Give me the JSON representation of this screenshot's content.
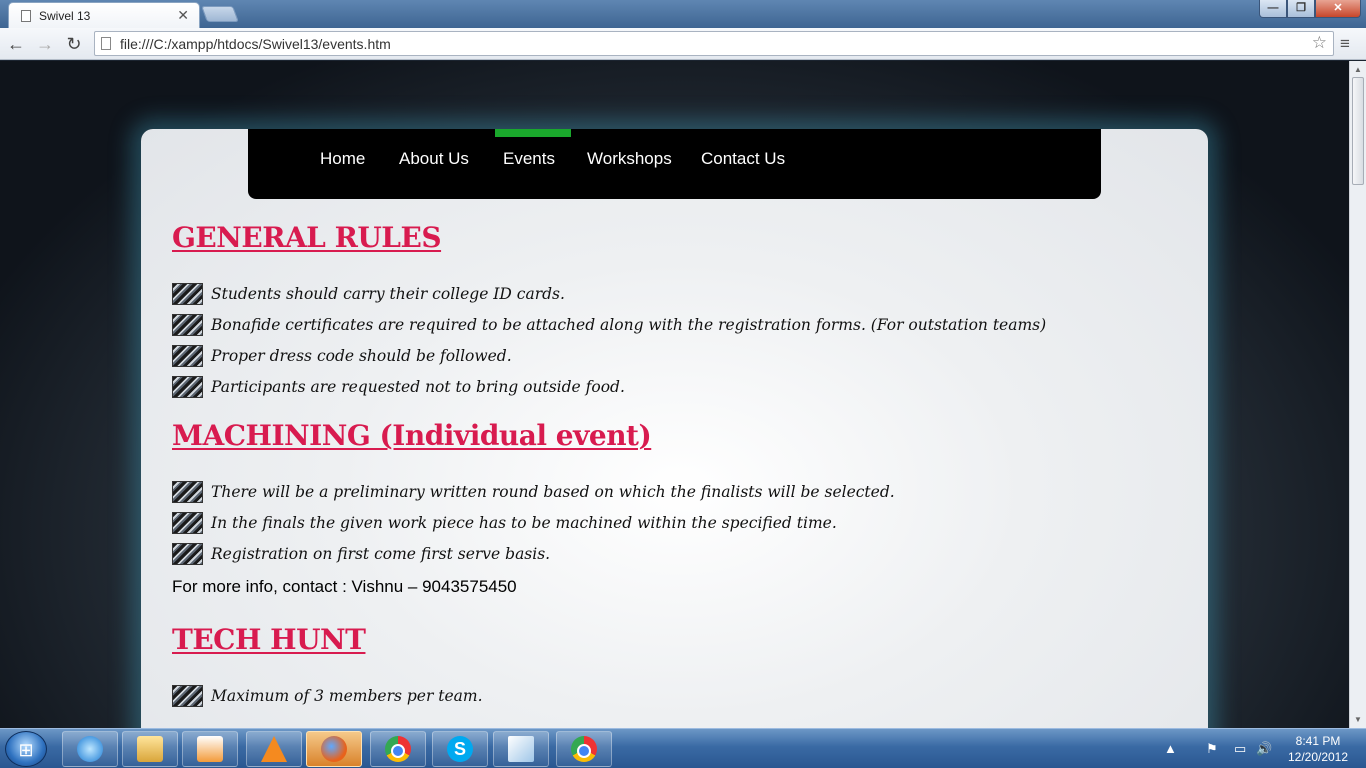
{
  "browser": {
    "tab_title": "Swivel 13",
    "tab_close": "✕",
    "url": "file:///C:/xampp/htdocs/Swivel13/events.htm",
    "back": "←",
    "forward": "→",
    "reload": "↻",
    "bookmark_star": "☆",
    "menu": "≡",
    "win_min": "—",
    "win_max": "❐",
    "win_close": "✕"
  },
  "nav": {
    "items": [
      {
        "label": "Home"
      },
      {
        "label": "About Us"
      },
      {
        "label": "Events"
      },
      {
        "label": "Workshops"
      },
      {
        "label": "Contact Us"
      }
    ],
    "active": "Events",
    "active_color": "#1aa82c"
  },
  "sections": [
    {
      "heading": "GENERAL RULES",
      "rules": [
        "Students should carry their college ID cards.",
        "Bonafide certificates are required to be attached along with the registration forms. (For outstation teams)",
        "Proper dress code should be followed.",
        "Participants are requested not to bring outside food."
      ]
    },
    {
      "heading": "MACHINING (Individual event)",
      "rules": [
        "There will be a preliminary written round based on which the finalists will be selected.",
        "In the finals the given work piece has to be machined within the specified time.",
        "Registration on first come first serve basis."
      ],
      "contact": "For more info, contact : Vishnu – 9043575450"
    },
    {
      "heading": "TECH HUNT",
      "rules": [
        "Maximum of 3 members per team."
      ]
    }
  ],
  "colors": {
    "heading": "#d81b4f",
    "navbar_bg": "#000000"
  },
  "taskbar": {
    "start_icon": "⊞",
    "skype_letter": "S",
    "tray_icons": [
      "▲",
      "⚑",
      "▭",
      "🔊"
    ],
    "time": "8:41 PM",
    "date": "12/20/2012"
  }
}
